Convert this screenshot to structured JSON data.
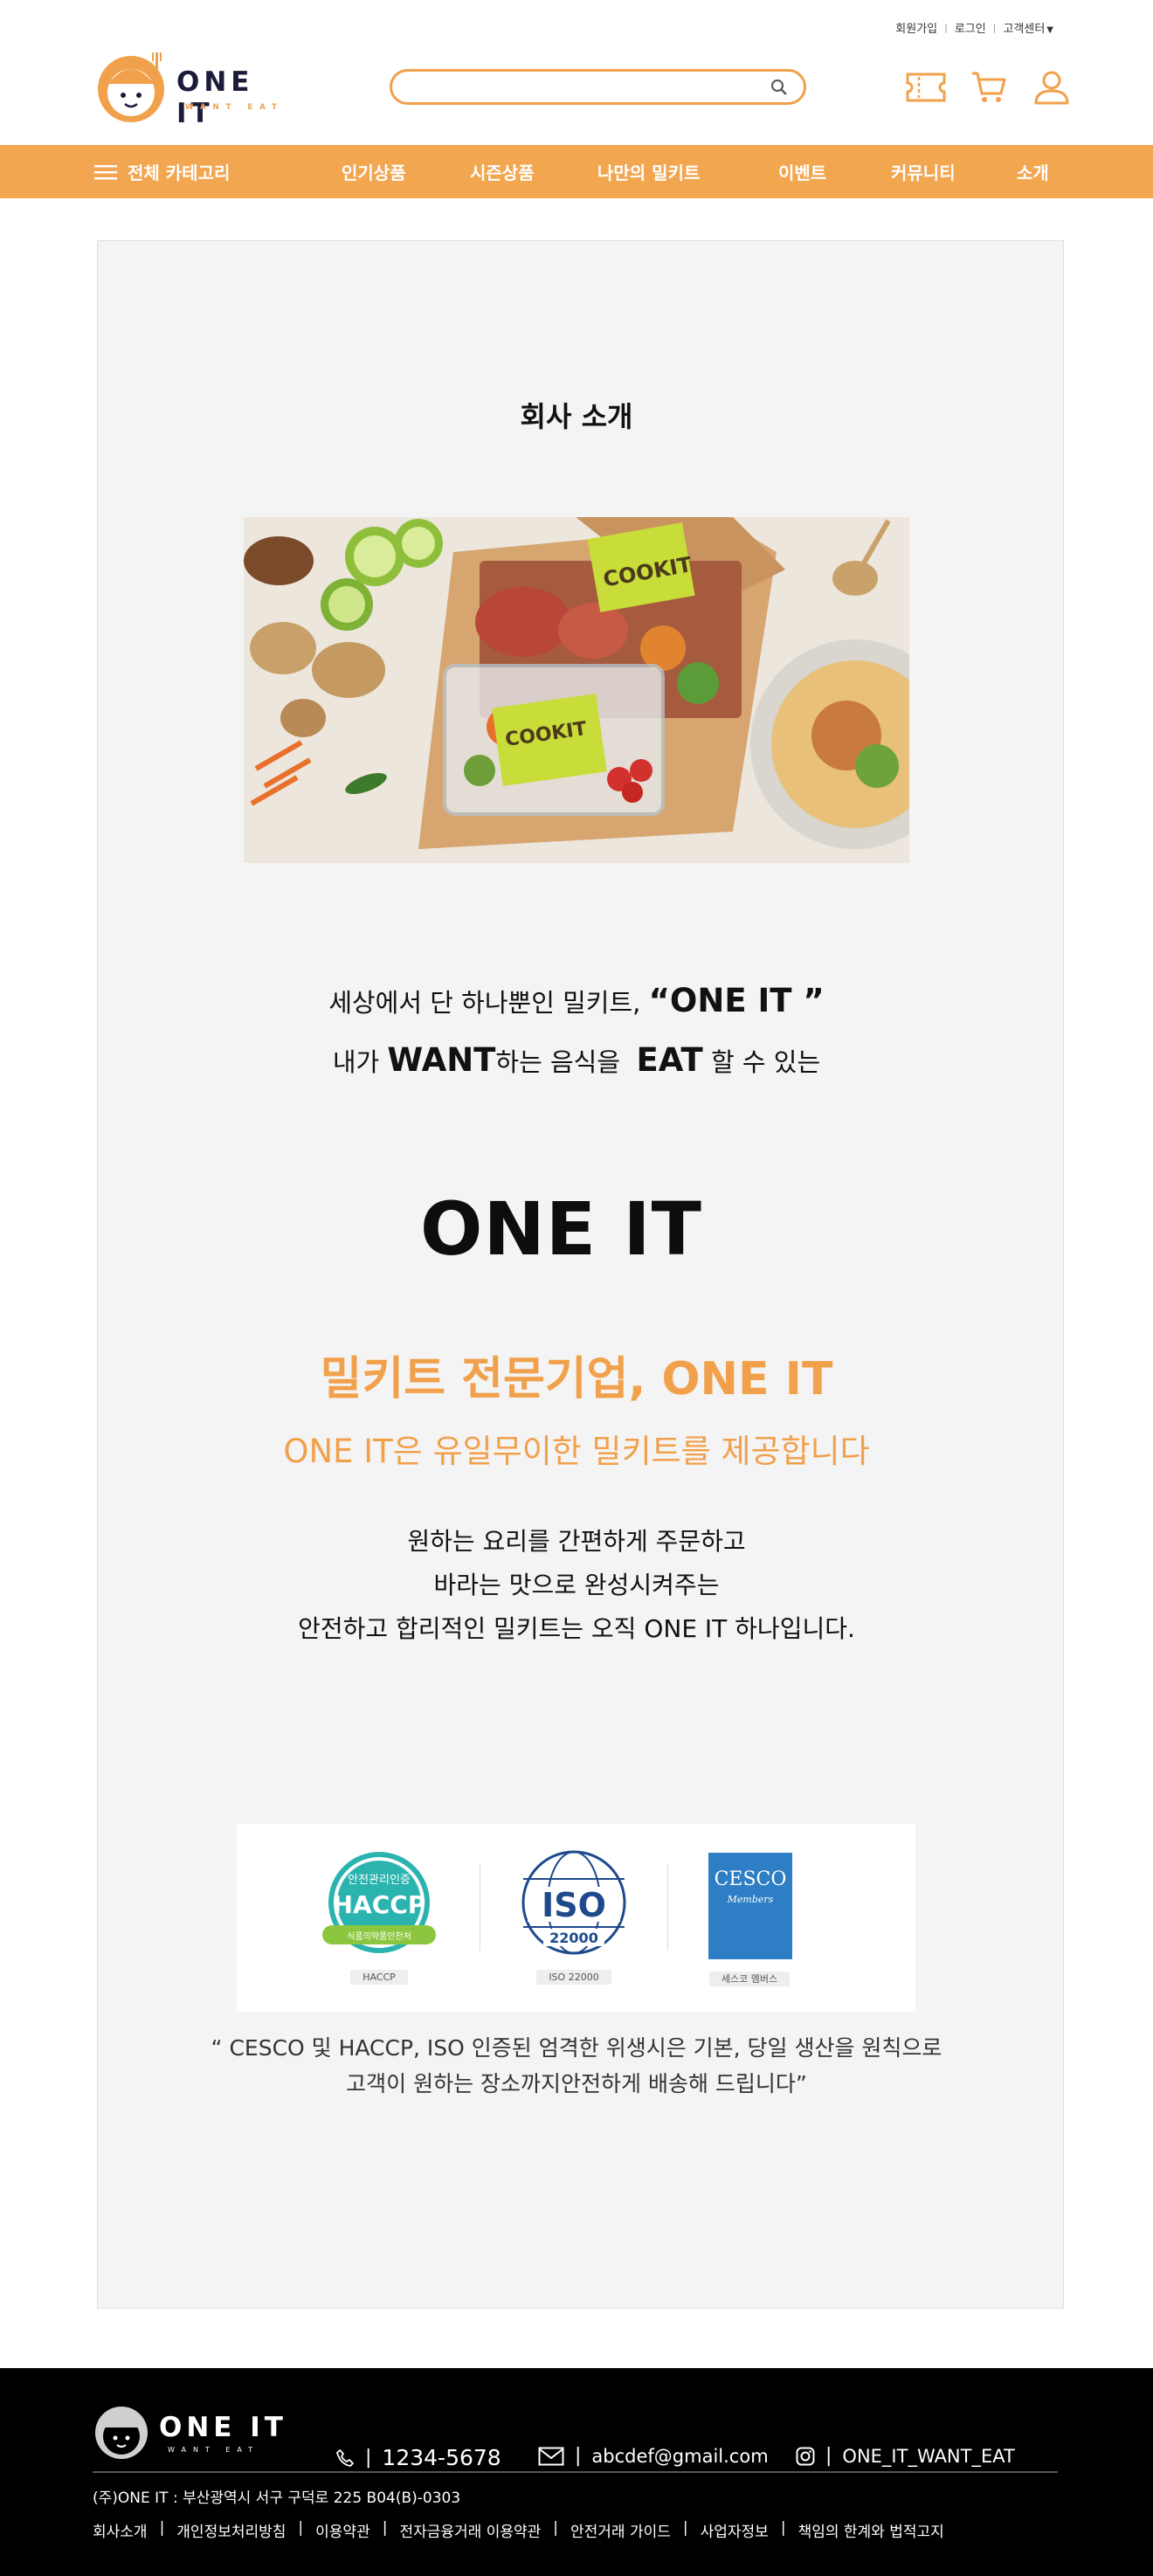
{
  "util_links": [
    "회원가입",
    "로그인",
    "고객센터"
  ],
  "logo": {
    "name": "ONE IT",
    "sub": "WANT EAT"
  },
  "search": {
    "placeholder": ""
  },
  "header_icons": [
    "coupon-icon",
    "cart-icon",
    "user-icon"
  ],
  "nav": {
    "all_category": "전체 카테고리",
    "items": [
      "인기상품",
      "시즌상품",
      "나만의 밀키트",
      "이벤트",
      "커뮤니티",
      "소개"
    ]
  },
  "main": {
    "title": "회사 소개",
    "tagline1_pre": "세상에서 단 하나뿐인 밀키트,",
    "tagline1_bold": "“ONE IT ”",
    "tagline2_a": "내가",
    "tagline2_want": "WANT",
    "tagline2_b": "하는 음식을",
    "tagline2_eat": "EAT",
    "tagline2_c": "할 수 있는",
    "brand": "ONE IT",
    "slogan1": "밀키트 전문기업, ONE IT",
    "slogan2": "ONE IT은 유일무이한 밀키트를 제공합니다",
    "desc1": "원하는 요리를  간편하게 주문하고",
    "desc2": "바라는 맛으로 완성시켜주는",
    "desc3": "안전하고 합리적인 밀키트는 오직 ONE IT 하나입니다."
  },
  "certs": {
    "haccp": {
      "top": "안전관리인증",
      "mark": "HACCP",
      "org": "식품의약품안전처",
      "caption": "HACCP"
    },
    "iso": {
      "mark": "ISO",
      "num": "22000",
      "caption": "ISO 22000"
    },
    "cesco": {
      "mark": "CESCO",
      "member": "Members",
      "caption": "세스코 멤버스"
    },
    "note1": "“ CESCO 및  HACCP, ISO 인증된 엄격한 위생시은 기본, 당일 생산을 원칙으로",
    "note2": "고객이 원하는 장소까지안전하게 배송해 드립니다”"
  },
  "hero": {
    "box_label": "COOKIT"
  },
  "footer": {
    "phone": "1234-5678",
    "email": "abcdef@gmail.com",
    "instagram": "ONE_IT_WANT_EAT",
    "address": "(주)ONE IT : 부산광역시 서구 구덕로 225 B04(B)-0303",
    "links": [
      "회사소개",
      "개인정보처리방침",
      "이용약관",
      "전자금융거래 이용약관",
      "안전거래 가이드",
      "사업자정보",
      "책임의 한계와 법적고지"
    ]
  },
  "colors": {
    "accent": "#f3a650",
    "footer_bg": "#000000",
    "panel_bg": "#f4f4f4"
  }
}
